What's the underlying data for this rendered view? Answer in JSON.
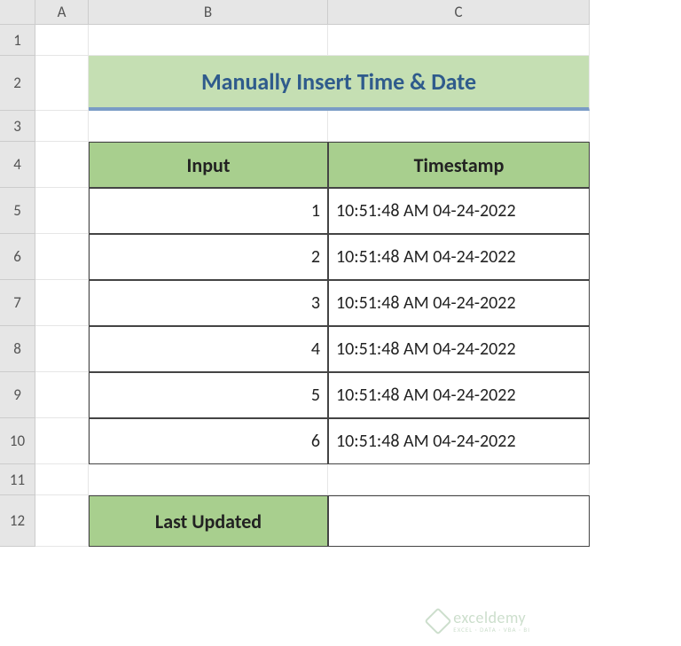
{
  "columns": [
    "A",
    "B",
    "C"
  ],
  "rows": [
    "1",
    "2",
    "3",
    "4",
    "5",
    "6",
    "7",
    "8",
    "9",
    "10",
    "11",
    "12"
  ],
  "title": "Manually Insert Time & Date",
  "headers": {
    "input": "Input",
    "timestamp": "Timestamp"
  },
  "data": [
    {
      "input": "1",
      "timestamp": "10:51:48 AM 04-24-2022"
    },
    {
      "input": "2",
      "timestamp": "10:51:48 AM 04-24-2022"
    },
    {
      "input": "3",
      "timestamp": "10:51:48 AM 04-24-2022"
    },
    {
      "input": "4",
      "timestamp": "10:51:48 AM 04-24-2022"
    },
    {
      "input": "5",
      "timestamp": "10:51:48 AM 04-24-2022"
    },
    {
      "input": "6",
      "timestamp": "10:51:48 AM 04-24-2022"
    }
  ],
  "last_updated_label": "Last Updated",
  "last_updated_value": "",
  "watermark": {
    "brand": "exceldemy",
    "tagline": "EXCEL · DATA · VBA · BI"
  }
}
